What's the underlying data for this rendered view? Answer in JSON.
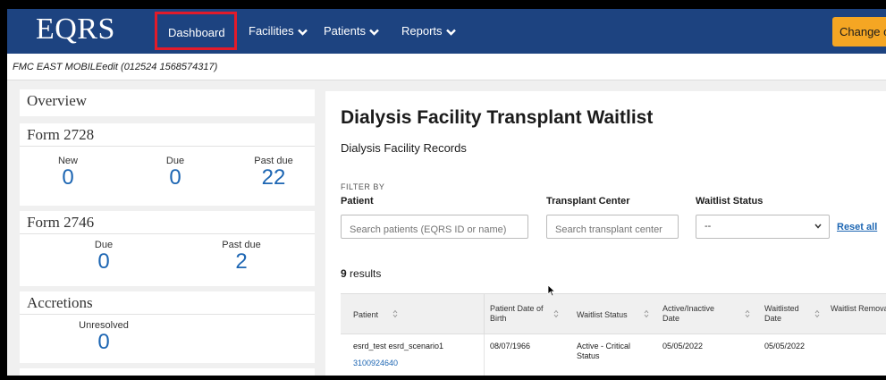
{
  "nav": {
    "logo": "EQRS",
    "dashboard": "Dashboard",
    "facilities": "Facilities",
    "patients": "Patients",
    "reports": "Reports",
    "change_button": "Change o"
  },
  "breadcrumb": "FMC EAST MOBILEedit (012524 1568574317)",
  "sidebar": {
    "overview": "Overview",
    "form2728": {
      "title": "Form 2728",
      "new_label": "New",
      "new_value": "0",
      "due_label": "Due",
      "due_value": "0",
      "pastdue_label": "Past due",
      "pastdue_value": "22"
    },
    "form2746": {
      "title": "Form 2746",
      "due_label": "Due",
      "due_value": "0",
      "pastdue_label": "Past due",
      "pastdue_value": "2"
    },
    "accretions": {
      "title": "Accretions",
      "unresolved_label": "Unresolved",
      "unresolved_value": "0"
    }
  },
  "main": {
    "title": "Dialysis Facility Transplant Waitlist",
    "subtitle": "Dialysis Facility Records",
    "filter_by": "FILTER BY",
    "patient_label": "Patient",
    "patient_placeholder": "Search patients (EQRS ID or name)",
    "center_label": "Transplant Center",
    "center_placeholder": "Search transplant center",
    "status_label": "Waitlist Status",
    "status_value": "--",
    "reset_all": "Reset all",
    "results_count": "9",
    "results_suffix": " results",
    "columns": [
      "Patient",
      "Patient Date of Birth",
      "Waitlist Status",
      "Active/Inactive Date",
      "Waitlisted Date",
      "Waitlist Removal Da"
    ],
    "rows": [
      {
        "patient": "esrd_test esrd_scenario1",
        "patient_id": "3100924640",
        "dob": "08/07/1966",
        "status": "Active - Critical Status",
        "active_date": "05/05/2022",
        "waitlisted_date": "05/05/2022"
      }
    ]
  },
  "colors": {
    "nav": "#1d4380",
    "accent": "#f5a623",
    "highlight": "#e21b2a",
    "link": "#1d66b3"
  }
}
